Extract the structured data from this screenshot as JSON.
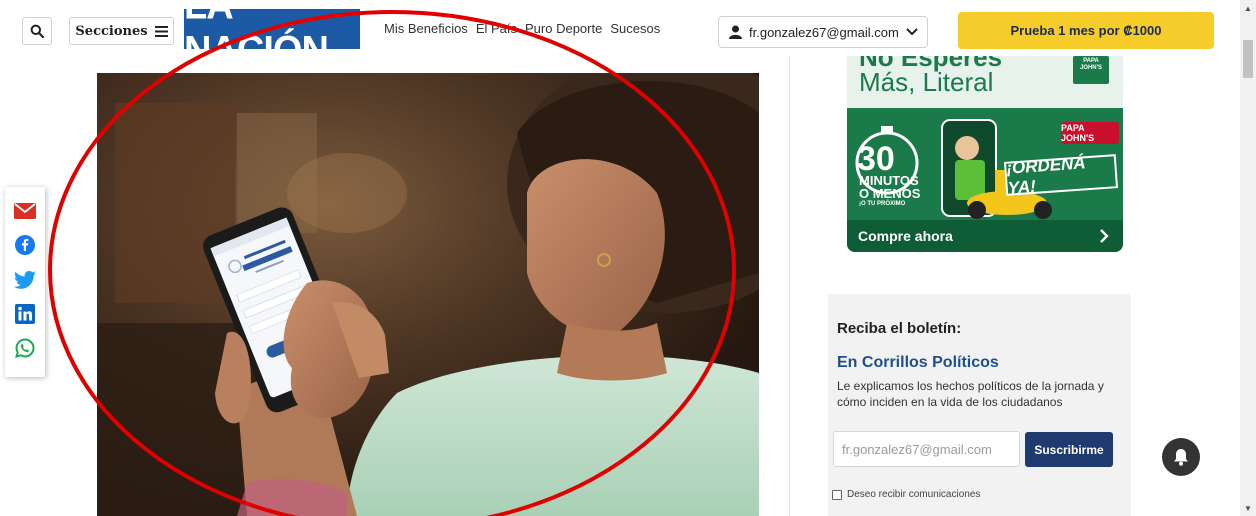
{
  "header": {
    "sections_label": "Secciones",
    "logo_text": "LA NACIÓN",
    "nav": [
      "Mis Beneficios",
      "El País",
      "Puro Deporte",
      "Sucesos"
    ],
    "account_email": "fr.gonzalez67@gmail.com",
    "trial_label": "Prueba 1 mes por ₡1000"
  },
  "photo": {
    "icons": [
      "phone-screen-icon"
    ]
  },
  "share": {
    "icons": [
      "email-icon",
      "facebook-icon",
      "twitter-icon",
      "linkedin-icon",
      "whatsapp-icon"
    ]
  },
  "ad": {
    "line1": "No Esperes",
    "line2": "Más, Literal",
    "mini_logo": "PAPA JOHN'S",
    "brand": "PAPA JOHN'S",
    "big_number": "30",
    "minutos": "MINUTOS",
    "o_menos": "O MENOS",
    "small_text": "¡O TU PRÓXIMO",
    "ordena": "¡ORDENÁ YA!",
    "cta": "Compre ahora"
  },
  "newsletter": {
    "heading": "Reciba el boletín:",
    "title": "En Corrillos Políticos",
    "description": "Le explicamos los hechos políticos de la jornada y cómo inciden en la vida de los ciudadanos",
    "email_value": "fr.gonzalez67@gmail.com",
    "subscribe_label": "Suscribirme",
    "checkbox_label": "Deseo recibir comunicaciones"
  },
  "colors": {
    "brand_blue": "#1d5aa6",
    "trial_yellow": "#f5cc2a",
    "ad_green": "#1b7a4a",
    "subscribe_navy": "#1e3a6e",
    "annotation_red": "#e00000"
  }
}
